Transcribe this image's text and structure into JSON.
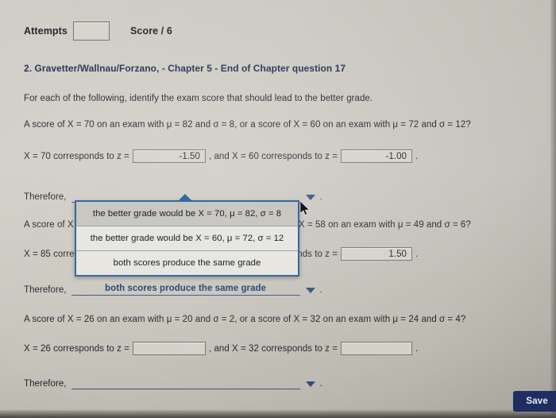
{
  "header": {
    "attempts_label": "Attempts",
    "attempts_value": "",
    "score_label": "Score / 6"
  },
  "question": {
    "heading": "2. Gravetter/Wallnau/Forzano, - Chapter 5 - End of Chapter question 17",
    "intro": "For each of the following, identify the exam score that should lead to the better grade."
  },
  "parts": [
    {
      "prompt": "A score of X = 70 on an exam with μ = 82 and σ = 8, or a score of X = 60 on an exam with μ = 72 and σ = 12?",
      "answer_prefix": "X = 70 corresponds to z =",
      "answer_value_1": "-1.50",
      "answer_middle": ", and X = 60 corresponds to z =",
      "answer_value_2": "-1.00",
      "answer_suffix": ".",
      "therefore_label": "Therefore,",
      "therefore_value": "",
      "therefore_period": "."
    },
    {
      "prompt": "A score of X = 85 on an exam with μ = 70 and σ = 10, or a score of X = 58 on an exam with μ = 49 and σ = 6?",
      "answer_prefix": "X = 85 corresponds to z =",
      "answer_value_1": "",
      "answer_middle": ", and X = 58 corresponds to z =",
      "answer_value_2": "1.50",
      "answer_suffix": ".",
      "therefore_label": "Therefore,",
      "therefore_value": "both scores produce the same grade",
      "therefore_period": "."
    },
    {
      "prompt": "A score of X = 26 on an exam with μ = 20 and σ = 2, or a score of X = 32 on an exam with μ = 24 and σ = 4?",
      "answer_prefix": "X = 26 corresponds to z =",
      "answer_value_1": "",
      "answer_middle": ", and X = 32 corresponds to z =",
      "answer_value_2": "",
      "answer_suffix": ".",
      "therefore_label": "Therefore,",
      "therefore_value": "",
      "therefore_period": "."
    }
  ],
  "dropdown": {
    "open": true,
    "options": [
      "the better grade would be X = 70, μ = 82, σ = 8",
      "the better grade would be X = 60, μ = 72, σ = 12",
      "both scores produce the same grade"
    ],
    "highlighted_index": 0
  },
  "footer": {
    "save_label": "Save"
  },
  "colors": {
    "page_background": "#c9c6bd",
    "heading_text": "#1d2b4d",
    "select_accent": "#2d4c7c",
    "dropdown_border": "#2f6ba3",
    "dropdown_highlight": "#c9c7c1",
    "save_button": "#1f2d63"
  }
}
